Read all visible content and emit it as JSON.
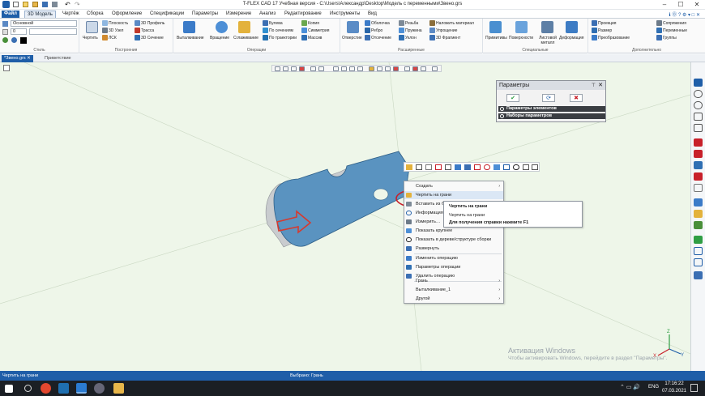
{
  "titlebar": {
    "title": "T-FLEX CAD 17 Учебная версия - C:\\Users\\Александр\\Desktop\\Модель с переменными\\Звено.grs",
    "minimize": "–",
    "maximize": "☐",
    "close": "✕"
  },
  "menu": {
    "items": [
      "Файл",
      "3D Модель",
      "Чертёж",
      "Сборка",
      "Оформление",
      "Спецификации",
      "Параметры",
      "Измерение",
      "Анализ",
      "Редактирование",
      "Инструменты",
      "Вид"
    ],
    "active": "3D Модель"
  },
  "ribbon": {
    "style_group": {
      "caption": "Стиль",
      "layer": "Основной",
      "number": "0"
    },
    "constructions": {
      "caption": "Построения",
      "draw": "Чертить",
      "plane": "Плоскость",
      "node3d": "3D Узел",
      "lcs": "ЛСК",
      "profile3d": "3D Профиль",
      "path": "Трасса",
      "section3d": "3D Сечение"
    },
    "operations": {
      "caption": "Операции",
      "extrude": "Выталкивание",
      "revolve": "Вращение",
      "smooth": "Сглаживание",
      "boolean": "Булева",
      "by_sections": "По сечениям",
      "by_path": "По траектории",
      "copy": "Копия",
      "symmetry": "Симметрия",
      "array": "Массив"
    },
    "extended": {
      "caption": "Расширенные",
      "hole": "Отверстие",
      "shell": "Оболочка",
      "rib": "Ребро",
      "cut": "Отсечение",
      "thread": "Резьба",
      "spring": "Пружина",
      "slope": "Уклон",
      "apply_material": "Наложить материал",
      "simplify": "Упрощение",
      "fragment3d": "3D Фрагмент"
    },
    "special": {
      "caption": "Специальные",
      "primitives": "Примитивы",
      "surfaces": "Поверхности",
      "sheet_metal": "Листовой металл",
      "deformation": "Деформация"
    },
    "extra": {
      "caption": "Дополнительно",
      "projection": "Проекция",
      "size": "Размер",
      "transform": "Преобразование",
      "mating": "Сопряжения",
      "variables": "Переменные",
      "groups": "Группы"
    }
  },
  "doc_tabs": [
    "*Звено.grs",
    "Приветствие"
  ],
  "panel": {
    "title": "Параметры",
    "ok": "✔",
    "apply": "⟳",
    "cancel": "✖",
    "section1": "Параметры элементов",
    "section2": "Наборы параметров"
  },
  "context_menu": {
    "items": [
      {
        "label": "Создать",
        "arrow": "›"
      },
      {
        "label": "Чертить на грани",
        "arrow": ""
      },
      {
        "label": "Вставить из бу…",
        "arrow": ""
      },
      {
        "label": "Информация…",
        "arrow": ""
      },
      {
        "label": "Измерить…",
        "arrow": ""
      },
      {
        "label": "Показать крупнее",
        "arrow": ""
      },
      {
        "label": "Показать в дереве/структуре сборки",
        "arrow": ""
      },
      {
        "label": "Развернуть",
        "arrow": ""
      },
      {
        "label": "Изменить операцию",
        "arrow": ""
      },
      {
        "label": "Параметры операции",
        "arrow": ""
      },
      {
        "label": "Удалить операцию",
        "arrow": ""
      },
      {
        "label": "Грань",
        "arrow": "›"
      },
      {
        "label": "Выталкивание_1",
        "arrow": "›"
      },
      {
        "label": "Другой",
        "arrow": "›"
      }
    ]
  },
  "tooltip": {
    "line1": "Чертить на грани",
    "line2": "Чертить на грани",
    "line3": "Для получения справки нажмите F1"
  },
  "watermark": {
    "title": "Активация Windows",
    "text": "Чтобы активировать Windows, перейдите в раздел \"Параметры\"."
  },
  "axes": {
    "x": "X",
    "y": "Y",
    "z": "Z"
  },
  "status": {
    "left": "Чертить на грани",
    "center": "Выбрано: Грань"
  },
  "taskbar": {
    "lang": "ENG",
    "time": "17:16:22",
    "date": "07.03.2021"
  },
  "colors": {
    "accent": "#1f5ea8",
    "part_face": "#5a93c0",
    "part_side": "#c9cccf",
    "viewport": "#eef6e9",
    "highlight_ellipse": "#c8202a"
  }
}
